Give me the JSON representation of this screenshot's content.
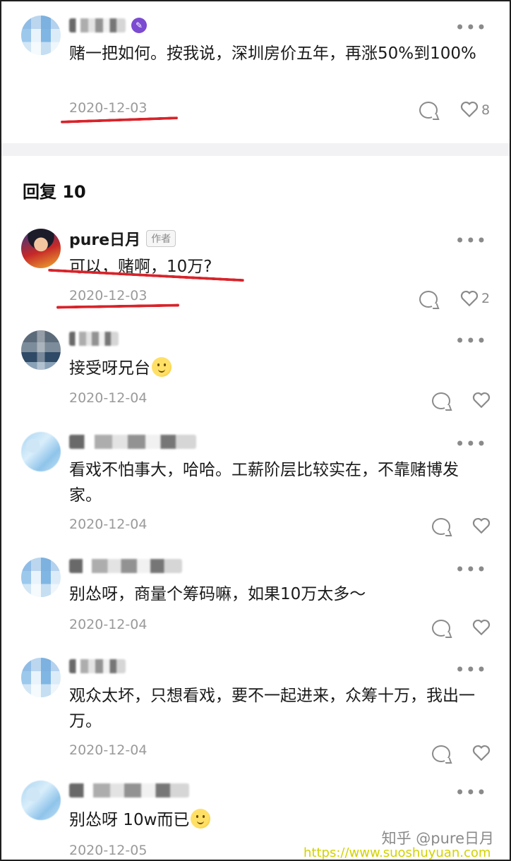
{
  "top_comment": {
    "text": "赌一把如何。按我说，深圳房价五年，再涨50%到100%",
    "date": "2020-12-03",
    "like_count": "8"
  },
  "section": {
    "title": "回复 10"
  },
  "replies": [
    {
      "username": "pure日月",
      "tag": "作者",
      "text": "可以，赌啊，10万?",
      "date": "2020-12-03",
      "like_count": "2"
    },
    {
      "text": "接受呀兄台",
      "date": "2020-12-04"
    },
    {
      "text": "看戏不怕事大，哈哈。工薪阶层比较实在，不靠赌博发家。",
      "date": "2020-12-04"
    },
    {
      "text": "别怂呀，商量个筹码嘛，如果10万太多～",
      "date": "2020-12-04"
    },
    {
      "text": "观众太坏，只想看戏，要不一起进来，众筹十万，我出一万。",
      "date": "2020-12-04"
    },
    {
      "text": "别怂呀 10w而已",
      "date": "2020-12-05"
    }
  ],
  "icons": {
    "more": "more-icon",
    "comment": "comment-icon",
    "like": "heart-icon",
    "badge": "purple-badge-icon"
  },
  "colors": {
    "highlight_red": "#d8232a",
    "url_yellow": "#d2d200",
    "meta_gray": "#9a9a9a"
  },
  "watermark": {
    "text": "知乎 @pure日月",
    "url": "https://www.suoshuyuan.com"
  }
}
